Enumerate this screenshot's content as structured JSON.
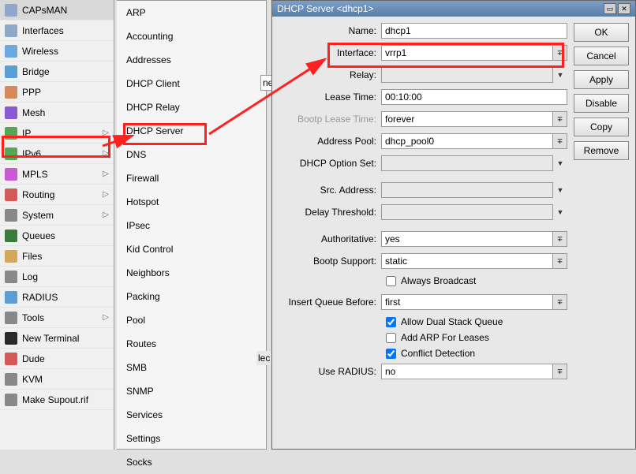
{
  "sidebar": {
    "items": [
      {
        "label": "CAPsMAN",
        "icon": "#8fa8c6"
      },
      {
        "label": "Interfaces",
        "icon": "#8fa8c6"
      },
      {
        "label": "Wireless",
        "icon": "#6ea6e0"
      },
      {
        "label": "Bridge",
        "icon": "#5a9fd4"
      },
      {
        "label": "PPP",
        "icon": "#d48a5a"
      },
      {
        "label": "Mesh",
        "icon": "#8a5ad4"
      },
      {
        "label": "IP",
        "icon": "#54a854",
        "expand": true
      },
      {
        "label": "IPv6",
        "icon": "#54a854",
        "expand": true
      },
      {
        "label": "MPLS",
        "icon": "#c95ad4",
        "expand": true
      },
      {
        "label": "Routing",
        "icon": "#d45a5a",
        "expand": true
      },
      {
        "label": "System",
        "icon": "#888888",
        "expand": true
      },
      {
        "label": "Queues",
        "icon": "#3a7a3a"
      },
      {
        "label": "Files",
        "icon": "#d4a85a"
      },
      {
        "label": "Log",
        "icon": "#888888"
      },
      {
        "label": "RADIUS",
        "icon": "#5a9fd4"
      },
      {
        "label": "Tools",
        "icon": "#888888",
        "expand": true
      },
      {
        "label": "New Terminal",
        "icon": "#2a2a2a"
      },
      {
        "label": "Dude",
        "icon": "#d45a5a"
      },
      {
        "label": "KVM",
        "icon": "#888888"
      },
      {
        "label": "Make Supout.rif",
        "icon": "#888888"
      }
    ]
  },
  "submenu": {
    "items": [
      "ARP",
      "Accounting",
      "Addresses",
      "DHCP Client",
      "DHCP Relay",
      "DHCP Server",
      "DNS",
      "Firewall",
      "Hotspot",
      "IPsec",
      "Kid Control",
      "Neighbors",
      "Packing",
      "Pool",
      "Routes",
      "SMB",
      "SNMP",
      "Services",
      "Settings",
      "Socks"
    ]
  },
  "dialog": {
    "title": "DHCP Server <dhcp1>",
    "buttons": {
      "ok": "OK",
      "cancel": "Cancel",
      "apply": "Apply",
      "disable": "Disable",
      "copy": "Copy",
      "remove": "Remove"
    },
    "fields": {
      "name_label": "Name:",
      "name": "dhcp1",
      "interface_label": "Interface:",
      "interface": "vrrp1",
      "relay_label": "Relay:",
      "relay": "",
      "lease_time_label": "Lease Time:",
      "lease_time": "00:10:00",
      "bootp_lease_time_label": "Bootp Lease Time:",
      "bootp_lease_time": "forever",
      "address_pool_label": "Address Pool:",
      "address_pool": "dhcp_pool0",
      "dhcp_option_set_label": "DHCP Option Set:",
      "dhcp_option_set": "",
      "src_address_label": "Src. Address:",
      "src_address": "",
      "delay_threshold_label": "Delay Threshold:",
      "delay_threshold": "",
      "authoritative_label": "Authoritative:",
      "authoritative": "yes",
      "bootp_support_label": "Bootp Support:",
      "bootp_support": "static",
      "always_broadcast_label": "Always Broadcast",
      "insert_queue_before_label": "Insert Queue Before:",
      "insert_queue_before": "first",
      "allow_dual_stack_label": "Allow Dual Stack Queue",
      "add_arp_label": "Add ARP For Leases",
      "conflict_detection_label": "Conflict Detection",
      "use_radius_label": "Use RADIUS:",
      "use_radius": "no"
    }
  },
  "partial_text": {
    "ne": "ne",
    "lec": "lec"
  }
}
